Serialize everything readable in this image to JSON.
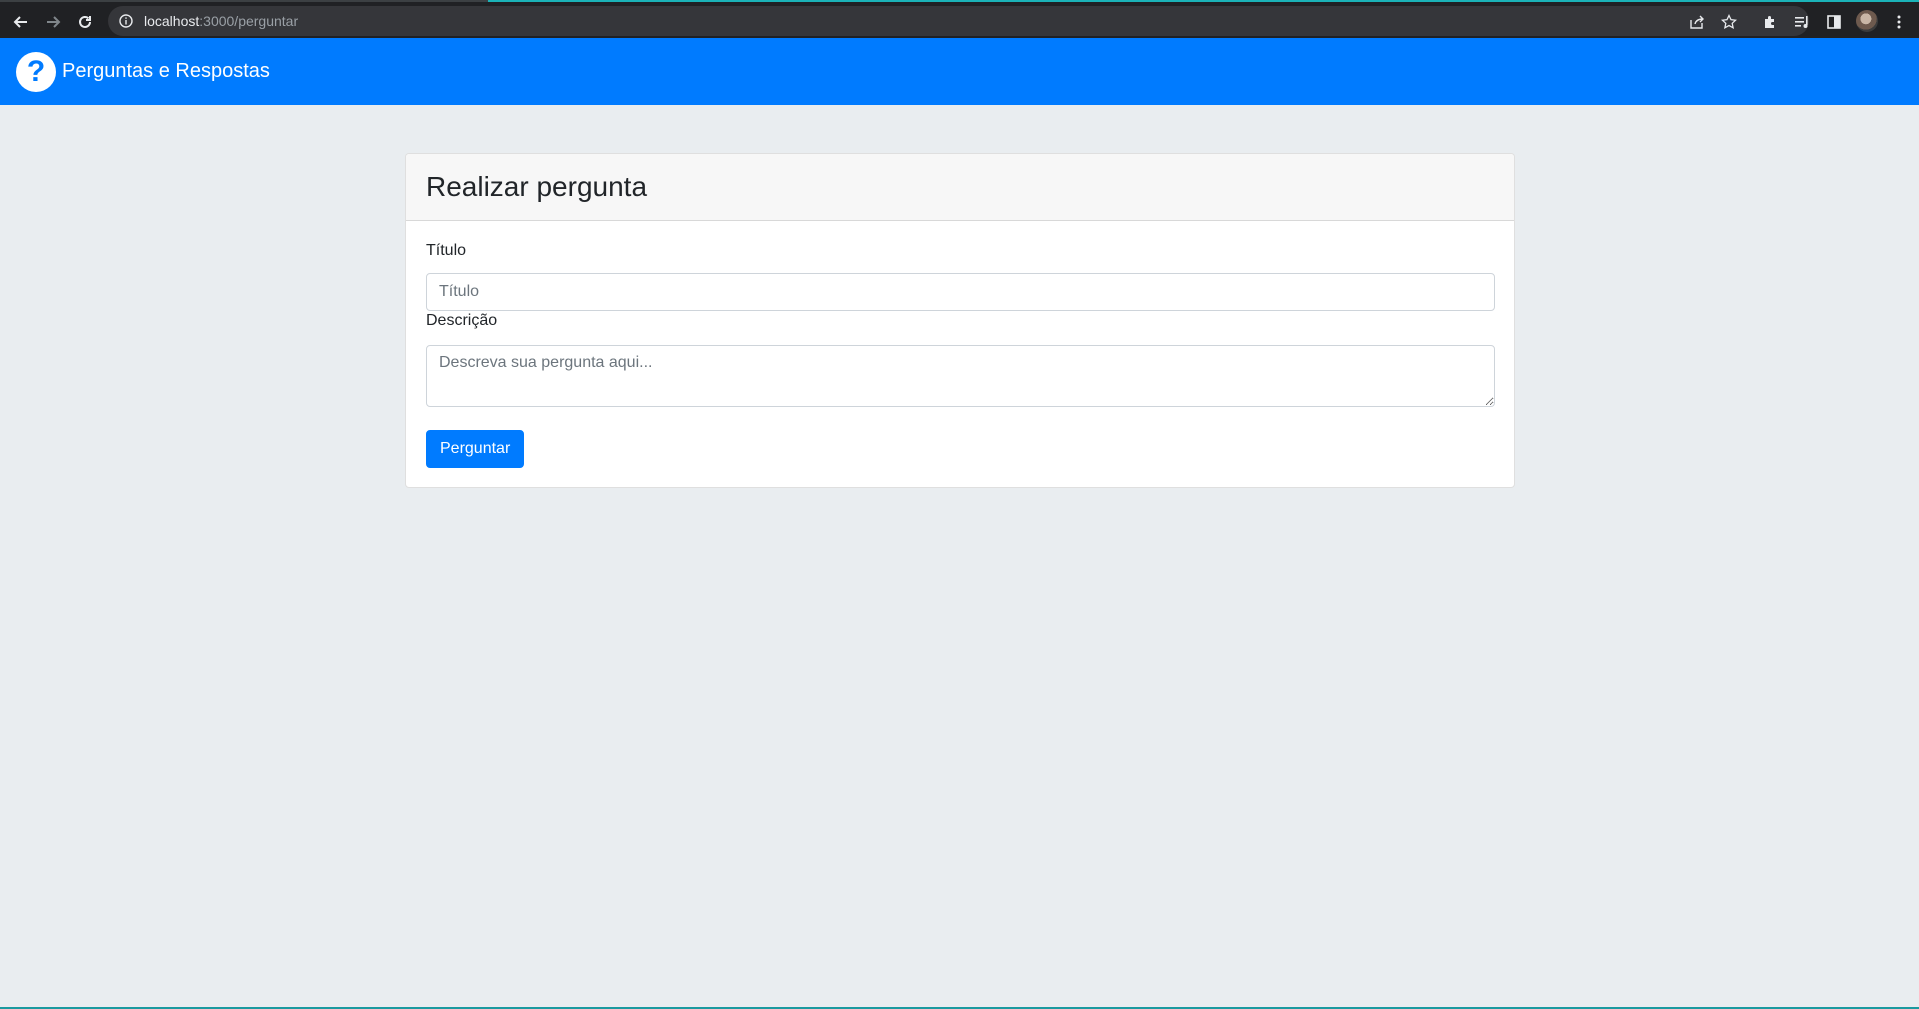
{
  "browser": {
    "url_host": "localhost",
    "url_path": ":3000/perguntar",
    "icons": {
      "back": "arrow-left-icon",
      "forward": "arrow-right-icon",
      "reload": "reload-icon",
      "site_info": "info-icon",
      "share": "share-icon",
      "bookmark": "star-icon",
      "extensions": "puzzle-icon",
      "media": "media-list-icon",
      "side_panel": "side-panel-icon",
      "profile": "avatar",
      "menu": "kebab-menu-icon"
    }
  },
  "navbar": {
    "logo_glyph": "?",
    "brand": "Perguntas e Respostas",
    "color": "#007bff"
  },
  "card": {
    "title": "Realizar pergunta",
    "form": {
      "title_label": "Título",
      "title_placeholder": "Título",
      "title_value": "",
      "description_label": "Descrição",
      "description_placeholder": "Descreva sua pergunta aqui...",
      "description_value": "",
      "submit_label": "Perguntar"
    }
  }
}
